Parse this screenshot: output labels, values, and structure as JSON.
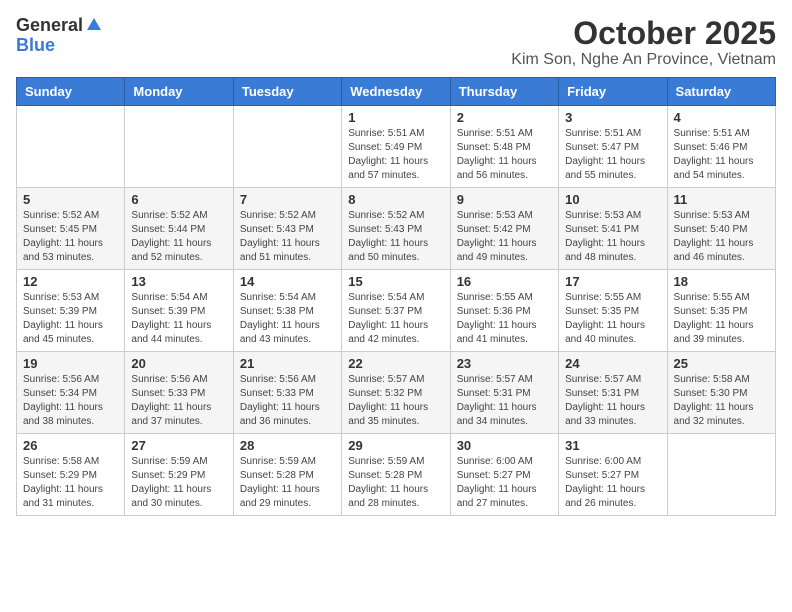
{
  "logo": {
    "general": "General",
    "blue": "Blue"
  },
  "title": "October 2025",
  "location": "Kim Son, Nghe An Province, Vietnam",
  "days_of_week": [
    "Sunday",
    "Monday",
    "Tuesday",
    "Wednesday",
    "Thursday",
    "Friday",
    "Saturday"
  ],
  "weeks": [
    [
      {
        "day": "",
        "sunrise": "",
        "sunset": "",
        "daylight": ""
      },
      {
        "day": "",
        "sunrise": "",
        "sunset": "",
        "daylight": ""
      },
      {
        "day": "",
        "sunrise": "",
        "sunset": "",
        "daylight": ""
      },
      {
        "day": "1",
        "sunrise": "Sunrise: 5:51 AM",
        "sunset": "Sunset: 5:49 PM",
        "daylight": "Daylight: 11 hours and 57 minutes."
      },
      {
        "day": "2",
        "sunrise": "Sunrise: 5:51 AM",
        "sunset": "Sunset: 5:48 PM",
        "daylight": "Daylight: 11 hours and 56 minutes."
      },
      {
        "day": "3",
        "sunrise": "Sunrise: 5:51 AM",
        "sunset": "Sunset: 5:47 PM",
        "daylight": "Daylight: 11 hours and 55 minutes."
      },
      {
        "day": "4",
        "sunrise": "Sunrise: 5:51 AM",
        "sunset": "Sunset: 5:46 PM",
        "daylight": "Daylight: 11 hours and 54 minutes."
      }
    ],
    [
      {
        "day": "5",
        "sunrise": "Sunrise: 5:52 AM",
        "sunset": "Sunset: 5:45 PM",
        "daylight": "Daylight: 11 hours and 53 minutes."
      },
      {
        "day": "6",
        "sunrise": "Sunrise: 5:52 AM",
        "sunset": "Sunset: 5:44 PM",
        "daylight": "Daylight: 11 hours and 52 minutes."
      },
      {
        "day": "7",
        "sunrise": "Sunrise: 5:52 AM",
        "sunset": "Sunset: 5:43 PM",
        "daylight": "Daylight: 11 hours and 51 minutes."
      },
      {
        "day": "8",
        "sunrise": "Sunrise: 5:52 AM",
        "sunset": "Sunset: 5:43 PM",
        "daylight": "Daylight: 11 hours and 50 minutes."
      },
      {
        "day": "9",
        "sunrise": "Sunrise: 5:53 AM",
        "sunset": "Sunset: 5:42 PM",
        "daylight": "Daylight: 11 hours and 49 minutes."
      },
      {
        "day": "10",
        "sunrise": "Sunrise: 5:53 AM",
        "sunset": "Sunset: 5:41 PM",
        "daylight": "Daylight: 11 hours and 48 minutes."
      },
      {
        "day": "11",
        "sunrise": "Sunrise: 5:53 AM",
        "sunset": "Sunset: 5:40 PM",
        "daylight": "Daylight: 11 hours and 46 minutes."
      }
    ],
    [
      {
        "day": "12",
        "sunrise": "Sunrise: 5:53 AM",
        "sunset": "Sunset: 5:39 PM",
        "daylight": "Daylight: 11 hours and 45 minutes."
      },
      {
        "day": "13",
        "sunrise": "Sunrise: 5:54 AM",
        "sunset": "Sunset: 5:39 PM",
        "daylight": "Daylight: 11 hours and 44 minutes."
      },
      {
        "day": "14",
        "sunrise": "Sunrise: 5:54 AM",
        "sunset": "Sunset: 5:38 PM",
        "daylight": "Daylight: 11 hours and 43 minutes."
      },
      {
        "day": "15",
        "sunrise": "Sunrise: 5:54 AM",
        "sunset": "Sunset: 5:37 PM",
        "daylight": "Daylight: 11 hours and 42 minutes."
      },
      {
        "day": "16",
        "sunrise": "Sunrise: 5:55 AM",
        "sunset": "Sunset: 5:36 PM",
        "daylight": "Daylight: 11 hours and 41 minutes."
      },
      {
        "day": "17",
        "sunrise": "Sunrise: 5:55 AM",
        "sunset": "Sunset: 5:35 PM",
        "daylight": "Daylight: 11 hours and 40 minutes."
      },
      {
        "day": "18",
        "sunrise": "Sunrise: 5:55 AM",
        "sunset": "Sunset: 5:35 PM",
        "daylight": "Daylight: 11 hours and 39 minutes."
      }
    ],
    [
      {
        "day": "19",
        "sunrise": "Sunrise: 5:56 AM",
        "sunset": "Sunset: 5:34 PM",
        "daylight": "Daylight: 11 hours and 38 minutes."
      },
      {
        "day": "20",
        "sunrise": "Sunrise: 5:56 AM",
        "sunset": "Sunset: 5:33 PM",
        "daylight": "Daylight: 11 hours and 37 minutes."
      },
      {
        "day": "21",
        "sunrise": "Sunrise: 5:56 AM",
        "sunset": "Sunset: 5:33 PM",
        "daylight": "Daylight: 11 hours and 36 minutes."
      },
      {
        "day": "22",
        "sunrise": "Sunrise: 5:57 AM",
        "sunset": "Sunset: 5:32 PM",
        "daylight": "Daylight: 11 hours and 35 minutes."
      },
      {
        "day": "23",
        "sunrise": "Sunrise: 5:57 AM",
        "sunset": "Sunset: 5:31 PM",
        "daylight": "Daylight: 11 hours and 34 minutes."
      },
      {
        "day": "24",
        "sunrise": "Sunrise: 5:57 AM",
        "sunset": "Sunset: 5:31 PM",
        "daylight": "Daylight: 11 hours and 33 minutes."
      },
      {
        "day": "25",
        "sunrise": "Sunrise: 5:58 AM",
        "sunset": "Sunset: 5:30 PM",
        "daylight": "Daylight: 11 hours and 32 minutes."
      }
    ],
    [
      {
        "day": "26",
        "sunrise": "Sunrise: 5:58 AM",
        "sunset": "Sunset: 5:29 PM",
        "daylight": "Daylight: 11 hours and 31 minutes."
      },
      {
        "day": "27",
        "sunrise": "Sunrise: 5:59 AM",
        "sunset": "Sunset: 5:29 PM",
        "daylight": "Daylight: 11 hours and 30 minutes."
      },
      {
        "day": "28",
        "sunrise": "Sunrise: 5:59 AM",
        "sunset": "Sunset: 5:28 PM",
        "daylight": "Daylight: 11 hours and 29 minutes."
      },
      {
        "day": "29",
        "sunrise": "Sunrise: 5:59 AM",
        "sunset": "Sunset: 5:28 PM",
        "daylight": "Daylight: 11 hours and 28 minutes."
      },
      {
        "day": "30",
        "sunrise": "Sunrise: 6:00 AM",
        "sunset": "Sunset: 5:27 PM",
        "daylight": "Daylight: 11 hours and 27 minutes."
      },
      {
        "day": "31",
        "sunrise": "Sunrise: 6:00 AM",
        "sunset": "Sunset: 5:27 PM",
        "daylight": "Daylight: 11 hours and 26 minutes."
      },
      {
        "day": "",
        "sunrise": "",
        "sunset": "",
        "daylight": ""
      }
    ]
  ]
}
